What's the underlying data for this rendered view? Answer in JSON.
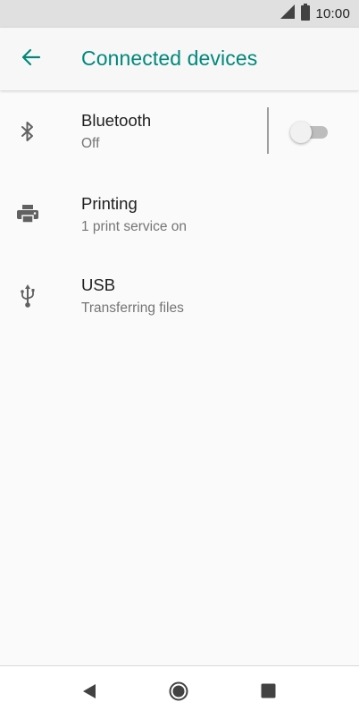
{
  "status_bar": {
    "time": "10:00",
    "icons": [
      "signal-icon",
      "battery-icon"
    ]
  },
  "app_bar": {
    "title": "Connected devices",
    "back_icon": "arrow-back-icon",
    "accent_color": "#00897b"
  },
  "items": [
    {
      "title": "Bluetooth",
      "subtitle": "Off",
      "icon": "bluetooth-icon",
      "toggle": false
    },
    {
      "title": "Printing",
      "subtitle": "1 print service on",
      "icon": "printer-icon"
    },
    {
      "title": "USB",
      "subtitle": "Transferring files",
      "icon": "usb-icon"
    }
  ],
  "nav_bar": {
    "buttons": [
      "back-triangle-icon",
      "home-circle-icon",
      "recents-square-icon"
    ]
  }
}
